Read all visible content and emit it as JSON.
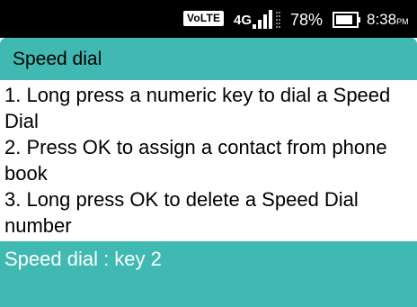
{
  "status_bar": {
    "volte": "VoLTE",
    "network": "4G",
    "battery_percent": "78%",
    "time": "8:38",
    "ampm": "PM",
    "icons": [
      "signal-icon",
      "battery-icon"
    ]
  },
  "header": {
    "title": "Speed dial"
  },
  "instructions": [
    "1. Long press a numeric key to dial a Speed Dial",
    "2. Press OK to assign a contact from phone book",
    "3. Long press OK to delete a Speed Dial number"
  ],
  "selected_item": {
    "label": "Speed dial : key 2"
  },
  "colors": {
    "accent": "#3fb9b1",
    "status_bar": "#000000",
    "background": "#ffffff"
  }
}
